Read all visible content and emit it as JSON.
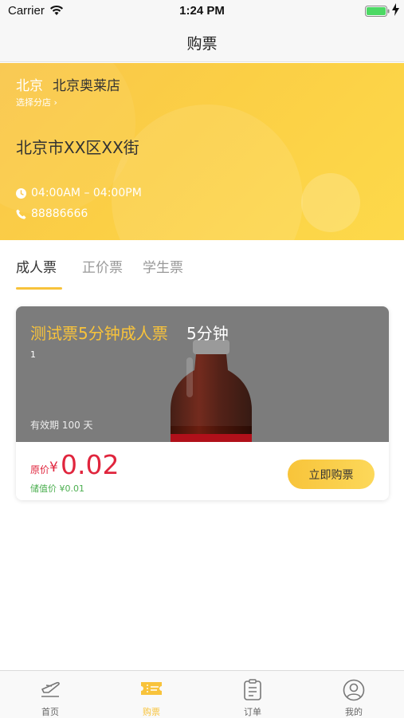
{
  "status_bar": {
    "carrier": "Carrier",
    "time": "1:24 PM"
  },
  "nav": {
    "title": "购票"
  },
  "store": {
    "city": "北京",
    "name": "北京奥莱店",
    "select_branch": "选择分店 ›",
    "address": "北京市XX区XX街",
    "hours": "04:00AM – 04:00PM",
    "phone": "88886666",
    "colors": {
      "gradient_start": "#f9c64a",
      "gradient_end": "#fdd94a"
    }
  },
  "tabs": [
    {
      "label": "成人票",
      "active": true
    },
    {
      "label": "正价票",
      "active": false
    },
    {
      "label": "学生票",
      "active": false
    }
  ],
  "ticket": {
    "name": "测试票5分钟成人票",
    "duration": "5分钟",
    "description": "1",
    "validity": "有效期 100 天",
    "original_label": "原价",
    "currency": "¥",
    "price": "0.02",
    "stored_value": "储值价 ¥0.01",
    "buy_button": "立即购票"
  },
  "tab_bar": [
    {
      "label": "首页",
      "icon": "plane-icon",
      "active": false
    },
    {
      "label": "购票",
      "icon": "ticket-icon",
      "active": true
    },
    {
      "label": "订单",
      "icon": "order-list-icon",
      "active": false
    },
    {
      "label": "我的",
      "icon": "user-icon",
      "active": false
    }
  ],
  "colors": {
    "accent": "#f8c33b",
    "price": "#e0253d",
    "stored_value": "#4caf50"
  }
}
